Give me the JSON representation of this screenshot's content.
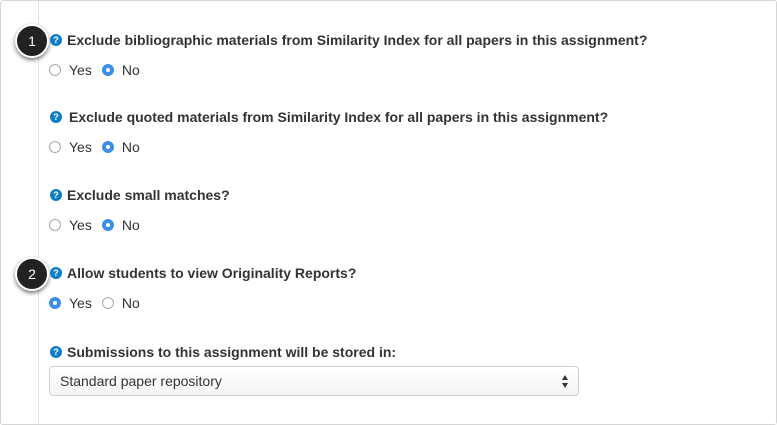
{
  "callouts": [
    "1",
    "2"
  ],
  "help_icon_glyph": "?",
  "questions": [
    {
      "label": "Exclude bibliographic materials from Similarity Index for all papers in this assignment?",
      "options": [
        {
          "label": "Yes",
          "checked": false
        },
        {
          "label": "No",
          "checked": true
        }
      ]
    },
    {
      "label": "Exclude quoted materials from Similarity Index for all papers in this assignment?",
      "options": [
        {
          "label": "Yes",
          "checked": false
        },
        {
          "label": "No",
          "checked": true
        }
      ]
    },
    {
      "label": "Exclude small matches?",
      "options": [
        {
          "label": "Yes",
          "checked": false
        },
        {
          "label": "No",
          "checked": true
        }
      ]
    },
    {
      "label": "Allow students to view Originality Reports?",
      "options": [
        {
          "label": "Yes",
          "checked": true
        },
        {
          "label": "No",
          "checked": false
        }
      ]
    }
  ],
  "repository": {
    "label": "Submissions to this assignment will be stored in:",
    "selected": "Standard paper repository"
  },
  "colors": {
    "accent": "#3c8ee8",
    "help_icon": "#0f7ec2",
    "callout": "#222222",
    "text": "#333333"
  }
}
